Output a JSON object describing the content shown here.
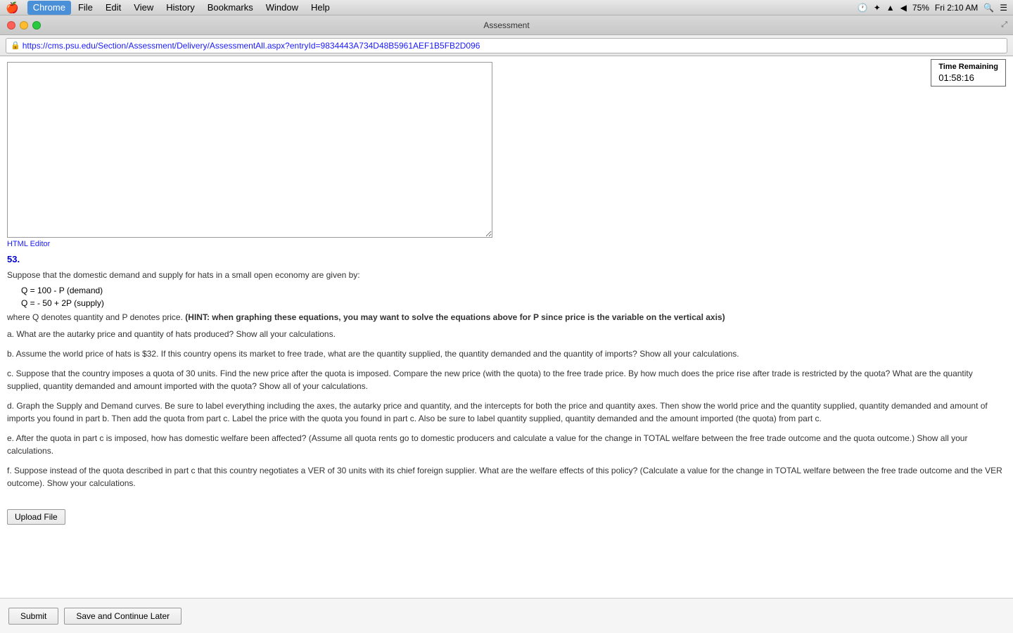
{
  "menubar": {
    "apple": "🍎",
    "items": [
      "Chrome",
      "File",
      "Edit",
      "View",
      "History",
      "Bookmarks",
      "Window",
      "Help"
    ],
    "active_item": "Chrome",
    "right": {
      "clock_icon": "🕐",
      "bluetooth": "bluetooth",
      "wifi": "wifi",
      "volume": "volume",
      "battery": "75%",
      "time": "Fri 2:10 AM",
      "search": "search",
      "list": "list"
    }
  },
  "titlebar": {
    "title": "Assessment"
  },
  "addressbar": {
    "url": "https://cms.psu.edu/Section/Assessment/Delivery/AssessmentAll.aspx?entryId=9834443A734D48B5961AEF1B5FB2D096"
  },
  "timer": {
    "label": "Time Remaining",
    "value": "01:58:16"
  },
  "html_editor_link": "HTML Editor",
  "question": {
    "number": "53.",
    "intro": "Suppose that the domestic demand and supply for hats in a small open economy are given by:",
    "equation_demand": "Q = 100 - P     (demand)",
    "equation_supply": "Q = - 50 + 2P     (supply)",
    "hint_text": "where Q denotes quantity and P denotes price. ",
    "hint_bold": "(HINT: when graphing these equations, you may want to solve the equations above for P since price is the variable on the vertical axis)",
    "part_a": "a. What are the autarky price and quantity of hats produced?  Show all your calculations.",
    "part_a_bold": "Show all your calculations.",
    "part_b_prefix": "b. Assume the world price of hats is $32.  If this country opens its market to free trade, what are the quantity supplied, the quantity demanded and the quantity of imports?  ",
    "part_b_bold": "Show all your calculations.",
    "part_c": "c. Suppose that the country imposes a quota of 30 units.  Find the new price after the quota is imposed.  Compare the new price (with the quota) to the free trade price.  By how much does the price rise after trade is restricted by the quota?  What are the quantity supplied, quantity demanded and amount imported with the quota?  Show all of your calculations.",
    "part_c_bold": "Show all of your calculations.",
    "part_d": "d. Graph the Supply and Demand curves.  Be sure to label everything including the axes, the autarky price and quantity, and the intercepts for both the price and quantity axes.   Then show the world price and the quantity supplied, quantity demanded and amount of imports you found in part b.  Then add the quota from part c.  Label the price with the quota you found in part c.  Also be sure to label quantity supplied, quantity demanded and the amount imported (the quota) from part c.",
    "part_e_prefix": "e. After the quota in part c is imposed, how has domestic welfare been affected?  (Assume all quota rents go to domestic producers and calculate a value for the change in TOTAL welfare between the free trade outcome and the quota outcome.) ",
    "part_e_bold": "Show all your calculations.",
    "part_f_prefix": "f. Suppose instead of the quota described in part c that this country negotiates a VER of 30 units with its chief foreign supplier. What are the welfare effects of this policy? (Calculate a value for the change in TOTAL welfare between the free trade outcome and the VER outcome).  ",
    "part_f_bold": "Show your calculations."
  },
  "upload_button_label": "Upload File",
  "submit_button_label": "Submit",
  "save_button_label": "Save and Continue Later"
}
